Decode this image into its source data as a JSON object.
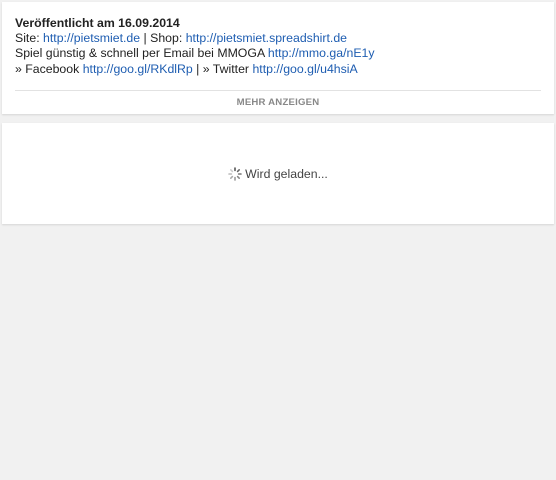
{
  "description": {
    "published": "Veröffentlicht am 16.09.2014",
    "line1": {
      "site_label": "Site: ",
      "site_link": "http://pietsmiet.de",
      "shop_label": " | Shop: ",
      "shop_link": "http://pietsmiet.spreadshirt.de"
    },
    "line2": {
      "text": "Spiel günstig & schnell per Email bei MMOGA ",
      "link": "http://mmo.ga/nE1y"
    },
    "line3": {
      "facebook_label": "» Facebook ",
      "facebook_link": "http://goo.gl/RKdlRp",
      "twitter_label": " | » Twitter ",
      "twitter_link": "http://goo.gl/u4hsiA"
    },
    "more_button": "MEHR ANZEIGEN"
  },
  "loading": {
    "icon": "loading-spinner-icon",
    "text": "Wird geladen..."
  },
  "colors": {
    "background": "#f1f1f1",
    "card": "#ffffff",
    "link": "#1e5db1",
    "more_button_text": "#888888"
  }
}
